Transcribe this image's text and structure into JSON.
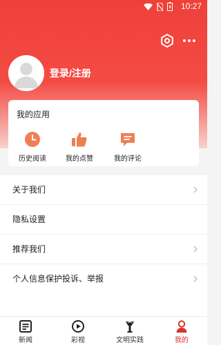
{
  "status_bar": {
    "time": "10:27"
  },
  "header": {
    "login_label": "登录/注册"
  },
  "apps": {
    "title": "我的应用",
    "items": [
      {
        "label": "历史阅读",
        "icon": "clock-icon"
      },
      {
        "label": "我的点赞",
        "icon": "thumbs-up-icon"
      },
      {
        "label": "我的评论",
        "icon": "comment-icon"
      }
    ]
  },
  "menu": {
    "group1": [
      {
        "label": "关于我们",
        "chevron": true
      },
      {
        "label": "隐私设置",
        "chevron": false
      }
    ],
    "group2": [
      {
        "label": "推荐我们",
        "chevron": true
      },
      {
        "label": "个人信息保护投诉、举报",
        "chevron": true
      }
    ]
  },
  "tabs": [
    {
      "label": "新闻",
      "icon": "news-icon",
      "active": false
    },
    {
      "label": "彩视",
      "icon": "play-icon",
      "active": false
    },
    {
      "label": "文明实践",
      "icon": "torch-icon",
      "active": false
    },
    {
      "label": "我的",
      "icon": "user-icon",
      "active": true
    }
  ],
  "colors": {
    "accent": "#f0403a",
    "active_tab": "#d8322b"
  }
}
